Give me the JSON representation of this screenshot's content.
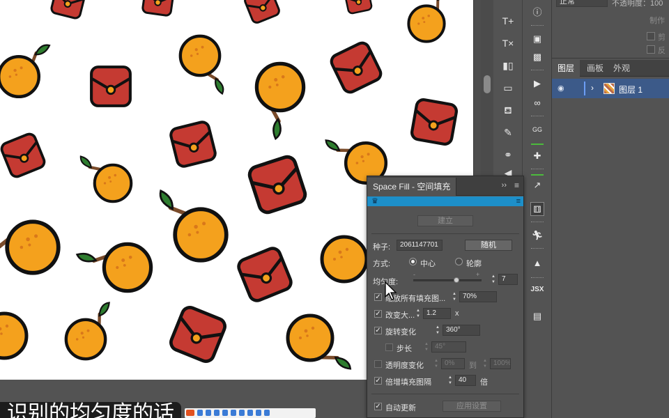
{
  "colors": {
    "orange": "#f4a11d",
    "red_packet": "#c53a32",
    "leaf": "#2e7d2f",
    "brand_bar": "#1d8fc9",
    "layer_selected": "#3c5a89"
  },
  "subtitle": {
    "text": "识别的均匀度的话"
  },
  "right_panel": {
    "blend_mode": "正常",
    "opacity_label": "不透明度：100",
    "make_button": "制作",
    "checkbox1_label": "剪",
    "checkbox2_label": "反",
    "tabs": [
      "图层",
      "画板",
      "外观"
    ],
    "layer": {
      "name": "图层 1",
      "visibility_icon": "eye-icon"
    }
  },
  "tool_icons": [
    "text-tool-icon",
    "text-clear-icon",
    "align-icon",
    "align-left-icon",
    "paint-bucket-icon",
    "eyedropper-icon",
    "link-icon",
    "triangle-icon"
  ],
  "space_fill": {
    "title": "Space Fill - 空间填充",
    "create_button": "建立",
    "seed_label": "种子:",
    "seed_value": "2061147701",
    "random_button": "随机",
    "mode_label": "方式:",
    "mode_options": [
      "中心",
      "轮廓"
    ],
    "mode_selected": "中心",
    "uniformity_label": "均匀度:",
    "uniformity_minus": "-",
    "uniformity_plus": "+",
    "uniformity_value": "7",
    "scale_all_label": "缩放所有填充图...",
    "scale_all_value": "70%",
    "resize_label": "改变大...",
    "resize_value": "1.2",
    "resize_unit": "x",
    "rotate_label": "旋转变化",
    "rotate_value": "360°",
    "step_label": "步长",
    "step_value": "45°",
    "opacity_label": "透明度变化",
    "opacity_from": "0%",
    "opacity_to_label": "到",
    "opacity_to": "100%",
    "spacing_label": "倍增填充图隔",
    "spacing_value": "40",
    "spacing_unit": "倍",
    "auto_update_label": "自动更新",
    "apply_button": "应用设置"
  }
}
